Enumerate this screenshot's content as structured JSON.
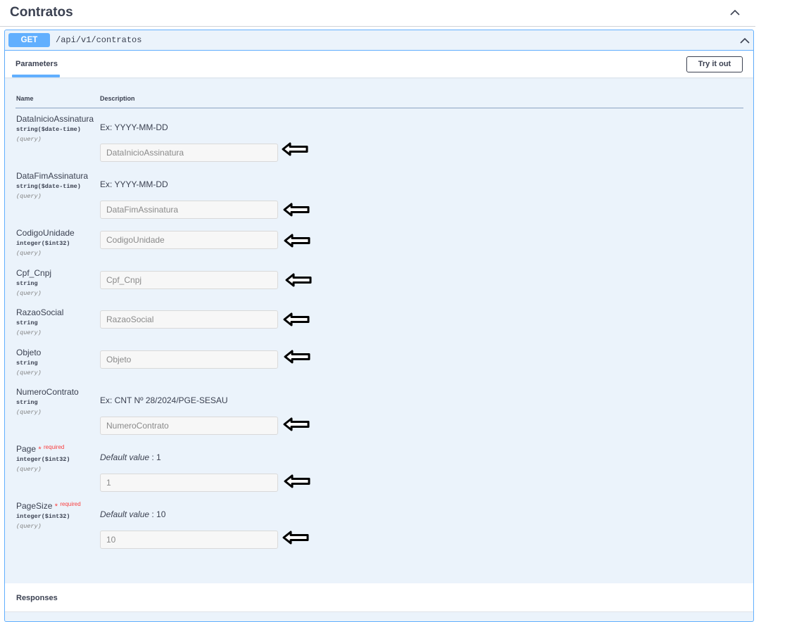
{
  "tag": {
    "title": "Contratos"
  },
  "operation": {
    "method": "GET",
    "path": "/api/v1/contratos",
    "tab": "Parameters",
    "try_button": "Try it out",
    "columns": {
      "name": "Name",
      "description": "Description"
    },
    "responses_title": "Responses",
    "colors": {
      "get": "#61affe",
      "required": "#f93e3e"
    }
  },
  "params": [
    {
      "name": "DataInicioAssinatura",
      "type": "string($date-time)",
      "in": "(query)",
      "desc": "Ex: YYYY-MM-DD",
      "placeholder": "DataInicioAssinatura"
    },
    {
      "name": "DataFimAssinatura",
      "type": "string($date-time)",
      "in": "(query)",
      "desc": "Ex: YYYY-MM-DD",
      "placeholder": "DataFimAssinatura"
    },
    {
      "name": "CodigoUnidade",
      "type": "integer($int32)",
      "in": "(query)",
      "placeholder": "CodigoUnidade"
    },
    {
      "name": "Cpf_Cnpj",
      "type": "string",
      "in": "(query)",
      "placeholder": "Cpf_Cnpj"
    },
    {
      "name": "RazaoSocial",
      "type": "string",
      "in": "(query)",
      "placeholder": "RazaoSocial"
    },
    {
      "name": "Objeto",
      "type": "string",
      "in": "(query)",
      "placeholder": "Objeto"
    },
    {
      "name": "NumeroContrato",
      "type": "string",
      "in": "(query)",
      "desc": "Ex: CNT Nº 28/2024/PGE-SESAU",
      "placeholder": "NumeroContrato"
    },
    {
      "name": "Page",
      "required_star": "*",
      "required_word": "required",
      "type": "integer($int32)",
      "in": "(query)",
      "default_label": "Default value",
      "default_sep": " : 1",
      "value": "1"
    },
    {
      "name": "PageSize",
      "required_star": "*",
      "required_word": "required",
      "type": "integer($int32)",
      "in": "(query)",
      "default_label": "Default value",
      "default_sep": " : 10",
      "value": "10"
    }
  ]
}
